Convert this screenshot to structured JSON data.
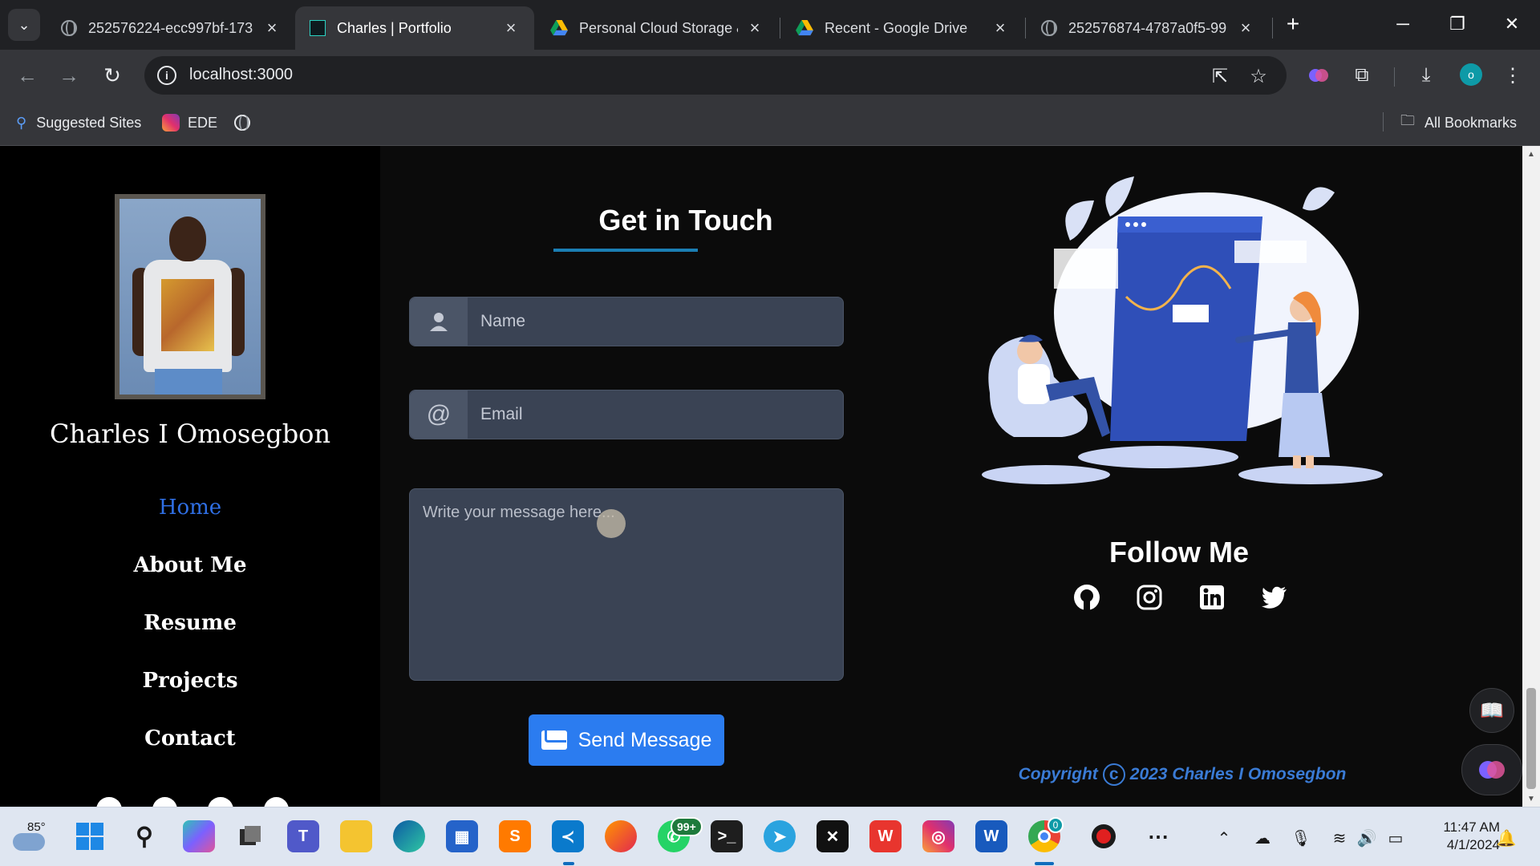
{
  "browser": {
    "tabs": [
      {
        "title": "252576224-ecc997bf-173",
        "favicon": "globe-icon",
        "active": false
      },
      {
        "title": "Charles | Portfolio",
        "favicon": "site-icon",
        "active": true
      },
      {
        "title": "Personal Cloud Storage &",
        "favicon": "google-drive-icon",
        "active": false
      },
      {
        "title": "Recent - Google Drive",
        "favicon": "google-drive-icon",
        "active": false
      },
      {
        "title": "252576874-4787a0f5-99",
        "favicon": "globe-icon",
        "active": false
      }
    ],
    "url": "localhost:3000",
    "profile_initial": "o",
    "bookmarks": [
      {
        "label": "Suggested Sites",
        "icon": "search-icon"
      },
      {
        "label": "EDE",
        "icon": "instagram-icon"
      },
      {
        "label": "",
        "icon": "globe-icon"
      }
    ],
    "all_bookmarks_label": "All Bookmarks"
  },
  "sidebar": {
    "name": "Charles I Omosegbon",
    "nav": [
      {
        "label": "Home",
        "active": true
      },
      {
        "label": "About Me",
        "active": false
      },
      {
        "label": "Resume",
        "active": false
      },
      {
        "label": "Projects",
        "active": false
      },
      {
        "label": "Contact",
        "active": false
      }
    ]
  },
  "contact": {
    "title": "Get in Touch",
    "name_placeholder": "Name",
    "email_placeholder": "Email",
    "message_placeholder": "Write your message here...",
    "send_label": "Send Message"
  },
  "follow": {
    "title": "Follow Me",
    "icons": [
      "github-icon",
      "instagram-icon",
      "linkedin-icon",
      "twitter-icon"
    ],
    "copyright_prefix": "Copyright",
    "copyright_text": "2023 Charles I Omosegbon"
  },
  "taskbar": {
    "temperature": "85°",
    "whatsapp_badge": "99+",
    "chrome_badge": "0",
    "time": "11:47 AM",
    "date": "4/1/2024"
  },
  "colors": {
    "accent_nav": "#2f6fe4",
    "send_button": "#2b7cf0",
    "title_underline": "#1b7fb4",
    "copyright": "#3a7bd5"
  }
}
